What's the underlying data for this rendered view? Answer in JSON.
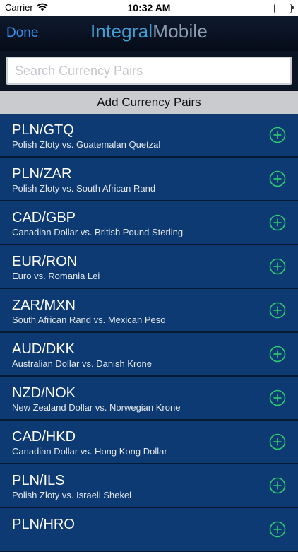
{
  "status_bar": {
    "carrier": "Carrier",
    "time": "10:32 AM"
  },
  "nav": {
    "done_label": "Done",
    "title_part1": "Integral",
    "title_part2": "Mobile"
  },
  "search": {
    "placeholder": "Search Currency Pairs",
    "value": ""
  },
  "section_header": "Add Currency Pairs",
  "pairs": [
    {
      "pair": "PLN/GTQ",
      "desc": "Polish Zloty vs. Guatemalan Quetzal"
    },
    {
      "pair": "PLN/ZAR",
      "desc": "Polish Zloty vs. South African Rand"
    },
    {
      "pair": "CAD/GBP",
      "desc": "Canadian Dollar vs. British Pound Sterling"
    },
    {
      "pair": "EUR/RON",
      "desc": "Euro vs. Romania Lei"
    },
    {
      "pair": "ZAR/MXN",
      "desc": "South African Rand vs. Mexican Peso"
    },
    {
      "pair": "AUD/DKK",
      "desc": "Australian Dollar vs. Danish Krone"
    },
    {
      "pair": "NZD/NOK",
      "desc": "New Zealand Dollar vs. Norwegian Krone"
    },
    {
      "pair": "CAD/HKD",
      "desc": "Canadian Dollar vs. Hong Kong Dollar"
    },
    {
      "pair": "PLN/ILS",
      "desc": "Polish Zloty vs. Israeli Shekel"
    },
    {
      "pair": "PLN/HRO",
      "desc": ""
    }
  ],
  "icons": {
    "add": "plus-circle-icon",
    "wifi": "wifi-icon",
    "battery": "battery-icon"
  },
  "colors": {
    "accent_done": "#3a8ef0",
    "add_icon": "#2ecc71",
    "row_background": "#0d3a72"
  }
}
